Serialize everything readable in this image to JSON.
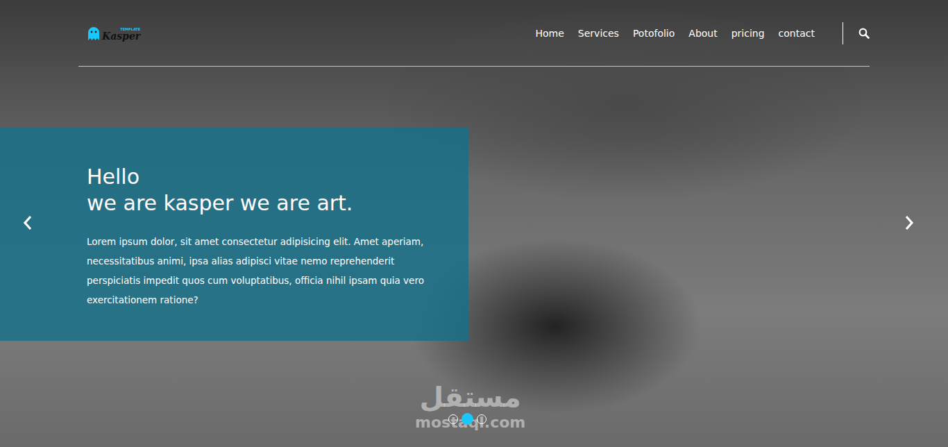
{
  "logo": {
    "name": "Kasper",
    "tag": "TEMPLATE"
  },
  "nav": {
    "items": [
      {
        "label": "Home"
      },
      {
        "label": "Services"
      },
      {
        "label": "Potofolio"
      },
      {
        "label": "About"
      },
      {
        "label": "pricing"
      },
      {
        "label": "contact"
      }
    ]
  },
  "hero": {
    "greeting": "Hello",
    "title": "we are kasper we are art.",
    "text": "Lorem ipsum dolor, sit amet consectetur adipisicing elit. Amet aperiam, necessitatibus animi, ipsa alias adipisci vitae nemo reprehenderit perspiciatis impedit quos cum voluptatibus, officia nihil ipsam quia vero exercitationem ratione?"
  },
  "slider": {
    "dots": [
      {
        "selected": false
      },
      {
        "selected": true
      },
      {
        "selected": false
      }
    ]
  },
  "watermark": {
    "arabic": "مستقل",
    "latin": "mostaql.com"
  }
}
